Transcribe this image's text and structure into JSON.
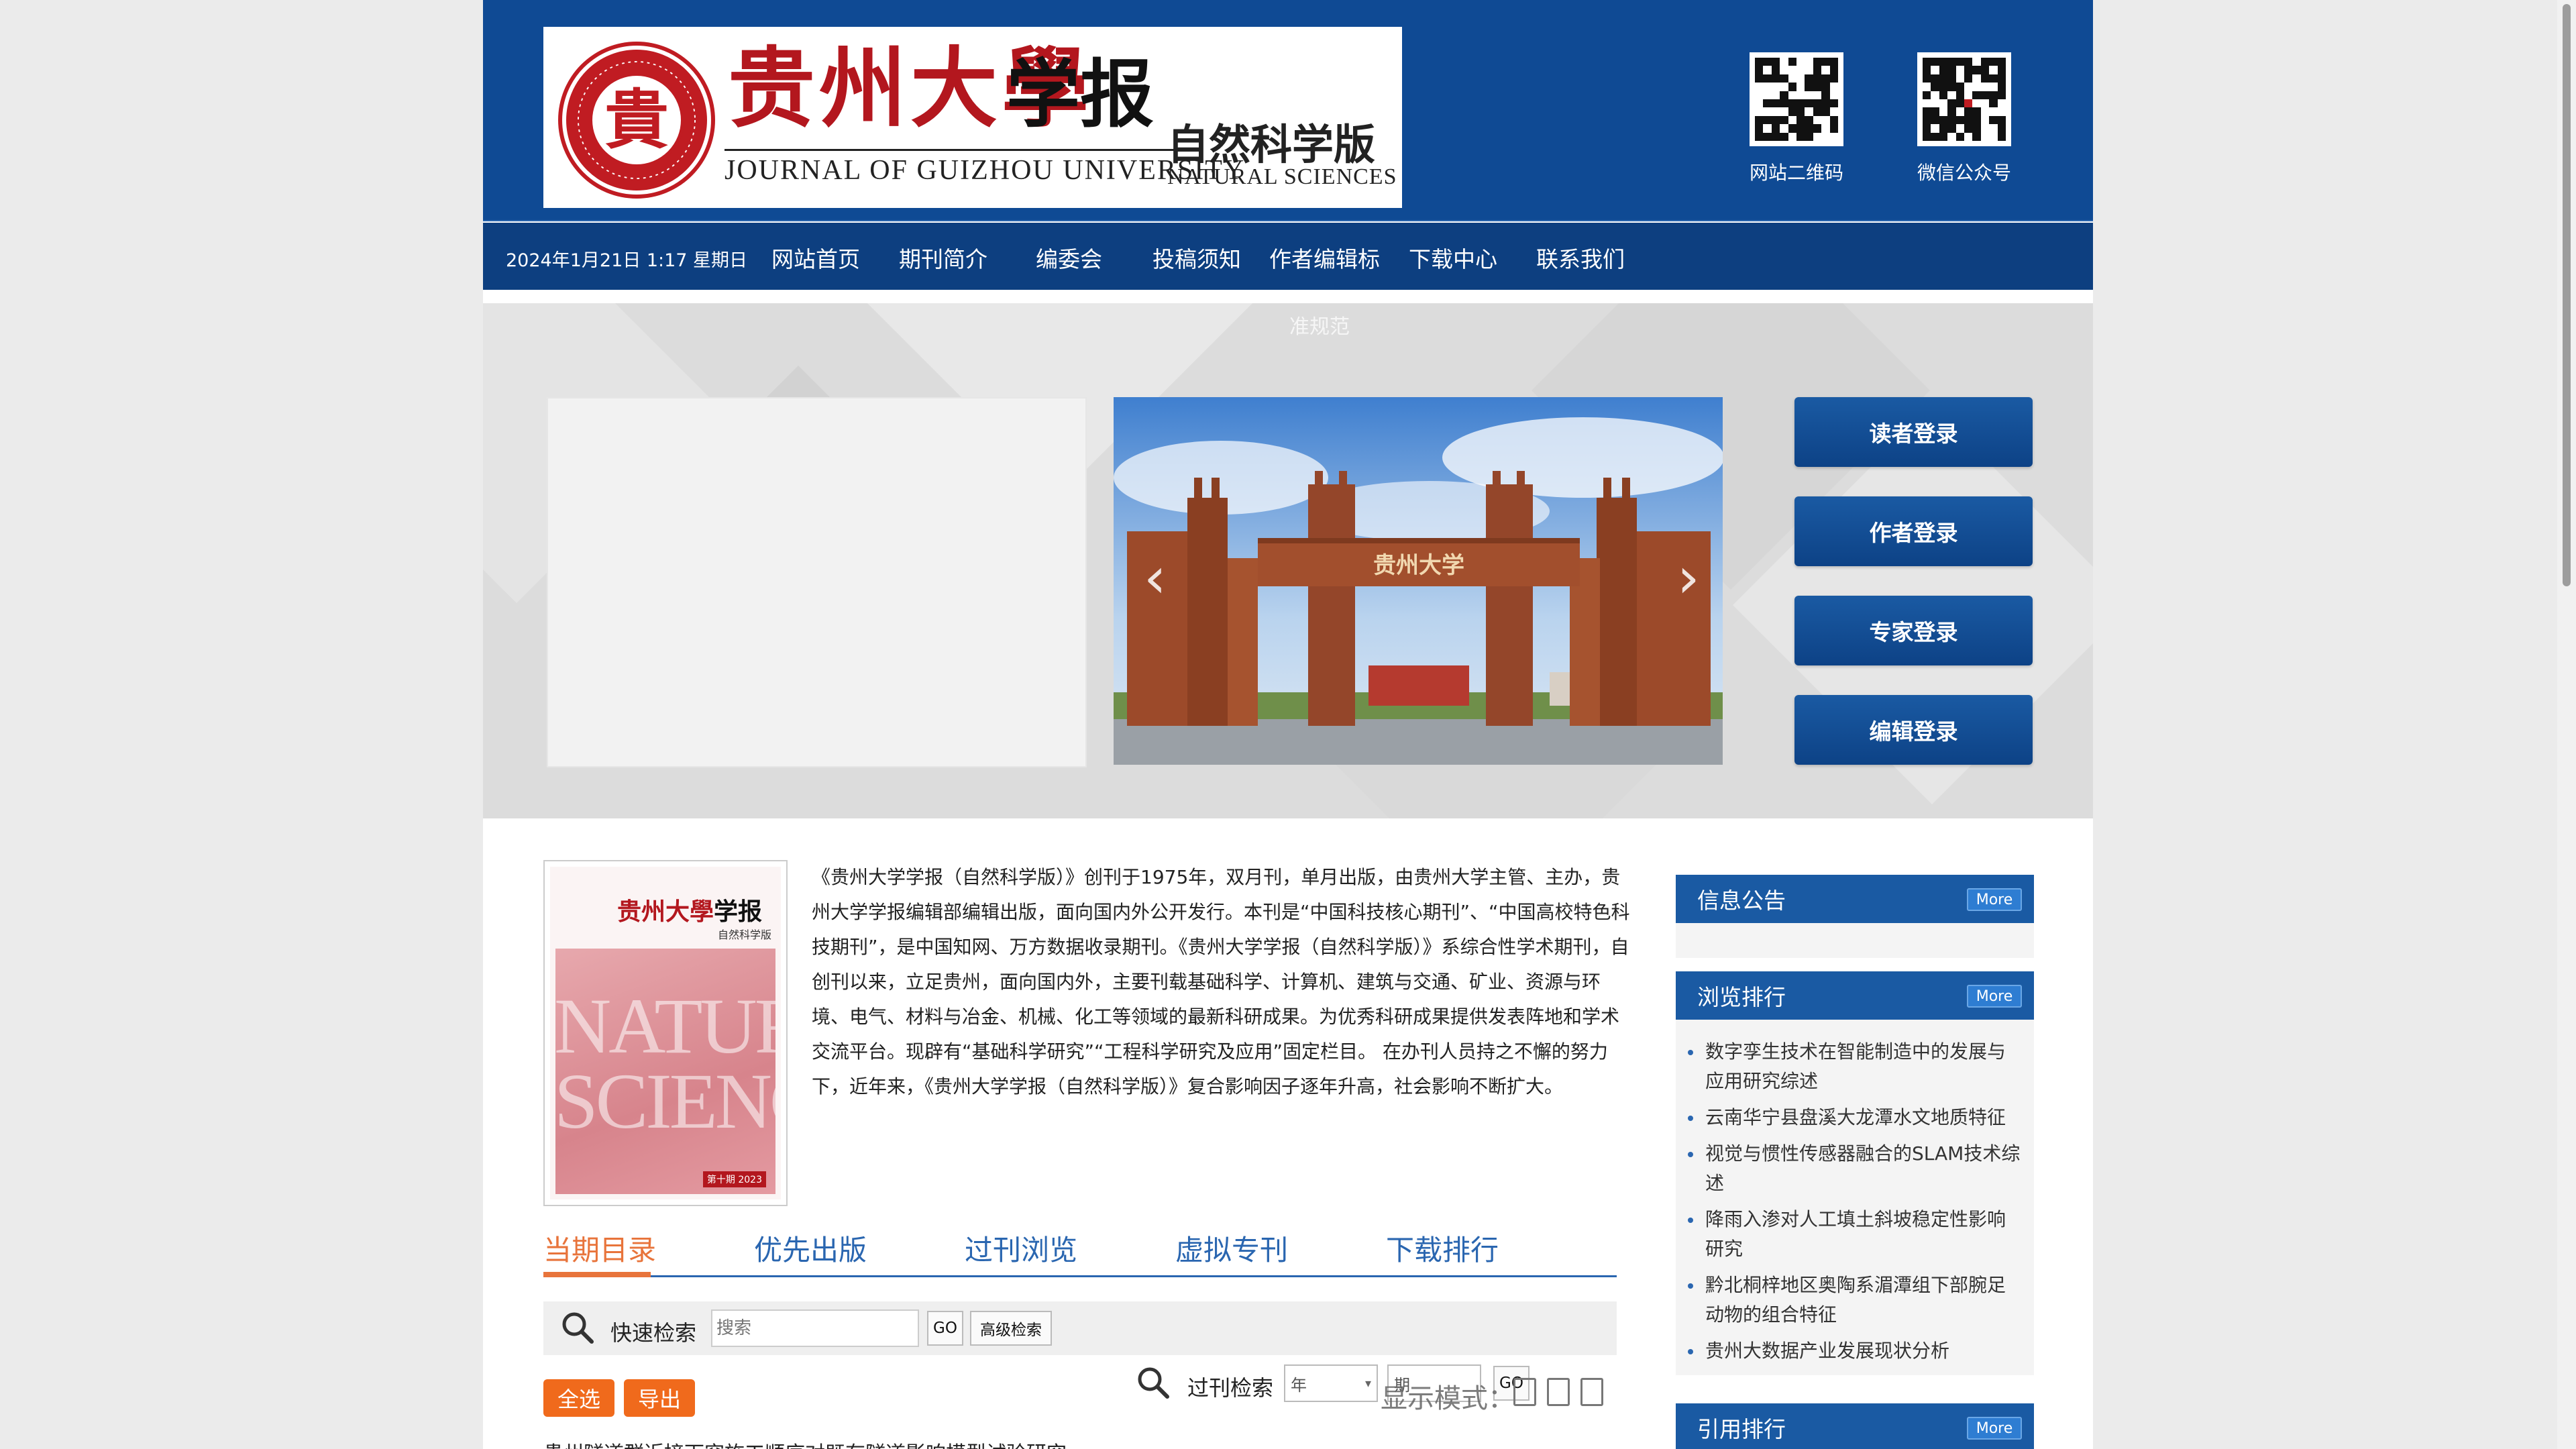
{
  "header": {
    "logo_cn": "贵州大學",
    "logo_xuebao": "学报",
    "logo_en": "JOURNAL OF GUIZHOU UNIVERSITY",
    "edition_cn": "自然科学版",
    "edition_en": "NATURAL SCIENCES",
    "seal_char": "貴",
    "qr_site_label": "网站二维码",
    "qr_wechat_label": "微信公众号"
  },
  "nav": {
    "datetime": "2024年1月21日 1:17 星期日",
    "items": [
      "网站首页",
      "期刊简介",
      "编委会",
      "投稿须知",
      "作者编辑标",
      "下载中心",
      "联系我们"
    ],
    "overflow_text": "准规范"
  },
  "banner": {
    "gate_text": "贵州大学",
    "prev_arrow": "‹",
    "next_arrow": "›",
    "login_buttons": [
      "读者登录",
      "作者登录",
      "专家登录",
      "编辑登录"
    ]
  },
  "cover": {
    "title_cn": "贵州大學",
    "title_xb": "学报",
    "edition": "自然科学版",
    "art_text": "NATURAL SCIENCES",
    "tag": "第十期 2023"
  },
  "intro": {
    "text": "《贵州大学学报（自然科学版）》创刊于1975年，双月刊，单月出版，由贵州大学主管、主办，贵州大学学报编辑部编辑出版，面向国内外公开发行。本刊是“中国科技核心期刊”、“中国高校特色科技期刊”，是中国知网、万方数据收录期刊。《贵州大学学报（自然科学版）》系综合性学术期刊，自创刊以来，立足贵州，面向国内外，主要刊载基础科学、计算机、建筑与交通、矿业、资源与环境、电气、材料与冶金、机械、化工等领域的最新科研成果。为优秀科研成果提供发表阵地和学术交流平台。现辟有“基础科学研究”“工程科学研究及应用”固定栏目。 在办刊人员持之不懈的努力下，近年来，《贵州大学学报（自然科学版）》复合影响因子逐年升高，社会影响不断扩大。"
  },
  "tabs": {
    "items": [
      "当期目录",
      "优先出版",
      "过刊浏览",
      "虚拟专刊",
      "下载排行"
    ],
    "active": "当期目录"
  },
  "search": {
    "label": "快速检索",
    "placeholder": "搜索",
    "go_label": "GO",
    "advanced_label": "高级检索"
  },
  "toolbar": {
    "select_all": "全选",
    "export": "导出",
    "issue_search_label": "过刊检索",
    "year_placeholder": "年",
    "issue_placeholder": "期",
    "go_label": "GO",
    "display_mode": "显示模式："
  },
  "list": {
    "partial_first_row": "贵州隧道群近接下穿施工顺序对既有隧道影响模型试验研究"
  },
  "sidebar": {
    "more_label": "More",
    "notices_title": "信息公告",
    "browse_title": "浏览排行",
    "browse_items": [
      "数字孪生技术在智能制造中的发展与应用研究综述",
      "云南华宁县盘溪大龙潭水文地质特征",
      "视觉与惯性传感器融合的SLAM技术综述",
      "降雨入渗对人工填土斜坡稳定性影响研究",
      "黔北桐梓地区奥陶系湄潭组下部腕足动物的组合特征",
      "贵州大数据产业发展现状分析"
    ],
    "cite_title": "引用排行"
  },
  "colors": {
    "header_blue": "#0f4a94",
    "nav_blue": "#0d3f80",
    "accent_orange": "#e8743b",
    "button_orange": "#f06a1c",
    "brand_red": "#b3171e",
    "tab_blue": "#2a66b0"
  }
}
